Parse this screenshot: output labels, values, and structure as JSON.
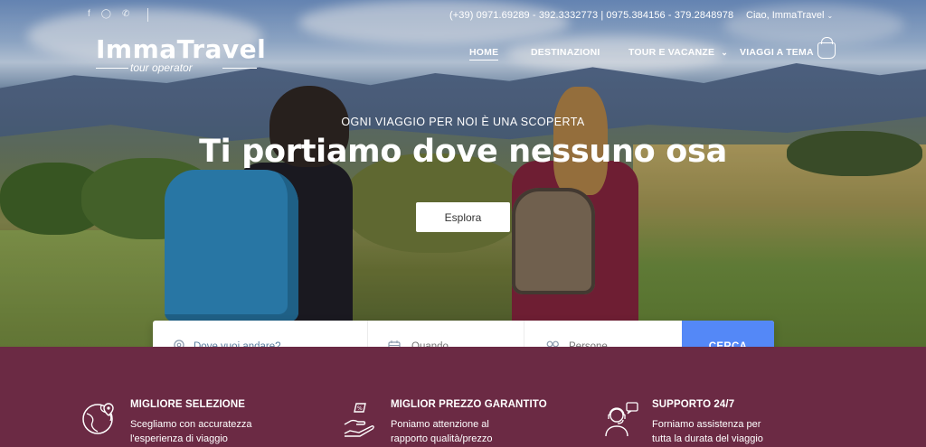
{
  "topbar": {
    "social_icons": [
      "facebook-icon",
      "instagram-icon",
      "whatsapp-icon"
    ],
    "phones": "(+39) 0971.69289 - 392.3332773 | 0975.384156 - 379.2848978",
    "user_greeting": "Ciao, ImmaTravel"
  },
  "logo": {
    "brand": "ImmaTravel",
    "subtitle": "tour operator"
  },
  "nav": {
    "items": [
      {
        "label": "HOME",
        "active": true
      },
      {
        "label": "DESTINAZIONI",
        "active": false
      },
      {
        "label": "TOUR E VACANZE",
        "active": false,
        "dropdown": true
      },
      {
        "label": "VIAGGI A TEMA",
        "active": false
      }
    ],
    "cart_icon": "basket-icon"
  },
  "hero": {
    "tagline": "OGNI VIAGGIO PER NOI È UNA SCOPERTA",
    "headline": "Ti portiamo dove nessuno osa",
    "cta_label": "Esplora"
  },
  "search": {
    "destination_placeholder": "Dove vuoi andare?",
    "date_placeholder": "Quando",
    "people_placeholder": "Persone",
    "button_label": "CERCA",
    "button_color": "#5488f7"
  },
  "features": [
    {
      "icon": "globe-map-icon",
      "title": "MIGLIORE SELEZIONE",
      "line1": "Scegliamo con accuratezza",
      "line2": "l'esperienza di viaggio"
    },
    {
      "icon": "price-hand-icon",
      "title": "MIGLIOR PREZZO GARANTITO",
      "line1": "Poniamo attenzione al",
      "line2": "rapporto qualità/prezzo"
    },
    {
      "icon": "support-agent-icon",
      "title": "SUPPORTO 24/7",
      "line1": "Forniamo assistenza per",
      "line2": "tutta la durata del viaggio"
    }
  ],
  "colors": {
    "accent": "#5488f7",
    "footer_band": "#6b2a44"
  }
}
